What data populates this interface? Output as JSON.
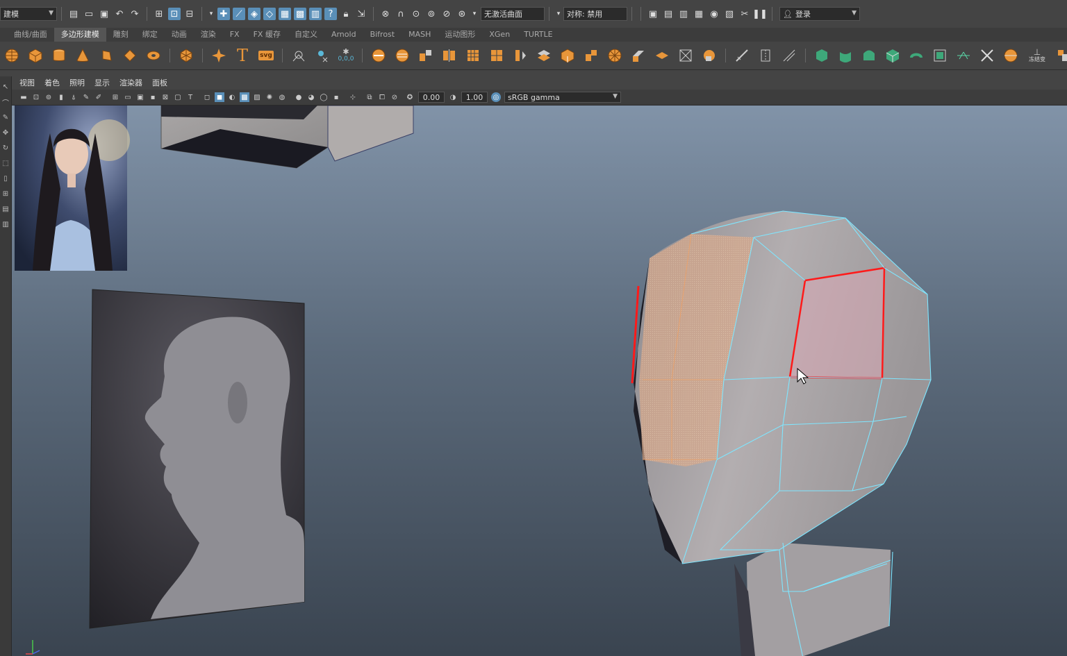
{
  "status_line": {
    "mode_menu_value": "建模",
    "live_surface_label": "无激活曲面",
    "symmetry_label": "对称: 禁用",
    "login_label": "登录"
  },
  "shelf_tabs": [
    {
      "label": "曲线/曲面",
      "active": false
    },
    {
      "label": "多边形建模",
      "active": true
    },
    {
      "label": "雕刻",
      "active": false
    },
    {
      "label": "绑定",
      "active": false
    },
    {
      "label": "动画",
      "active": false
    },
    {
      "label": "渲染",
      "active": false
    },
    {
      "label": "FX",
      "active": false
    },
    {
      "label": "FX 缓存",
      "active": false
    },
    {
      "label": "自定义",
      "active": false
    },
    {
      "label": "Arnold",
      "active": false
    },
    {
      "label": "Bifrost",
      "active": false
    },
    {
      "label": "MASH",
      "active": false
    },
    {
      "label": "运动图形",
      "active": false
    },
    {
      "label": "XGen",
      "active": false
    },
    {
      "label": "TURTLE",
      "active": false
    }
  ],
  "shelf": {
    "text_tool_label": "T",
    "svg_tool_label": "svg",
    "origin_label": "0,0,0",
    "bake_label": "冻结变"
  },
  "panel_menu": [
    "视图",
    "着色",
    "照明",
    "显示",
    "渲染器",
    "面板"
  ],
  "panel_toolbar": {
    "exposure_value": "0.00",
    "gamma_value": "1.00",
    "color_space_value": "sRGB gamma"
  },
  "colors": {
    "selection_highlight": "#5a8fb8",
    "face_selection": "#ff1a1a",
    "wireframe": "#7fe6ff",
    "preselect_faces": "#f2a060",
    "mesh": "#a8a4a6",
    "viewport_top": "#8193a8",
    "viewport_bottom": "#3a4450"
  }
}
